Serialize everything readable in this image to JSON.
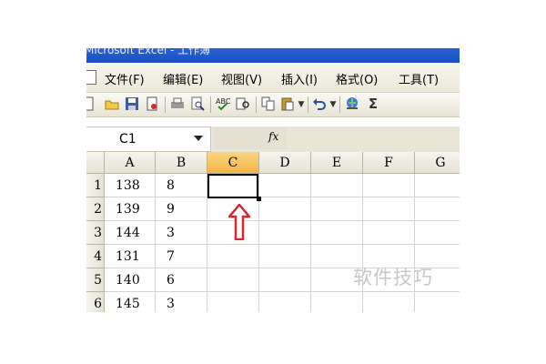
{
  "window": {
    "title": "Microsoft Excel - 工作簿"
  },
  "menu": [
    {
      "label": "文件(F)"
    },
    {
      "label": "编辑(E)"
    },
    {
      "label": "视图(V)"
    },
    {
      "label": "插入(I)"
    },
    {
      "label": "格式(O)"
    },
    {
      "label": "工具(T)"
    }
  ],
  "toolbar": {
    "icons": [
      "new-icon",
      "open-icon",
      "save-icon",
      "permission-icon",
      "print-icon",
      "print-preview-icon",
      "spelling-icon",
      "research-icon",
      "copy-icon",
      "paste-icon",
      "dropdown-icon",
      "undo-icon",
      "dropdown-icon",
      "hyperlink-icon",
      "autosum-icon"
    ],
    "autosum_label": "Σ"
  },
  "formula_bar": {
    "name_box": "C1",
    "fx_label": "fx",
    "content": ""
  },
  "sheet": {
    "columns": [
      "A",
      "B",
      "C",
      "D",
      "E",
      "F",
      "G"
    ],
    "active_column": "C",
    "rows": [
      {
        "header": "1",
        "A": "138",
        "B": "8"
      },
      {
        "header": "2",
        "A": "139",
        "B": "9"
      },
      {
        "header": "3",
        "A": "144",
        "B": "3"
      },
      {
        "header": "4",
        "A": "131",
        "B": "7"
      },
      {
        "header": "5",
        "A": "140",
        "B": "6"
      },
      {
        "header": "6",
        "A": "145",
        "B": "3"
      }
    ],
    "selected_cell": "C1"
  },
  "annotation": {
    "arrow_color": "#d9262c"
  },
  "watermark": "软件技巧"
}
